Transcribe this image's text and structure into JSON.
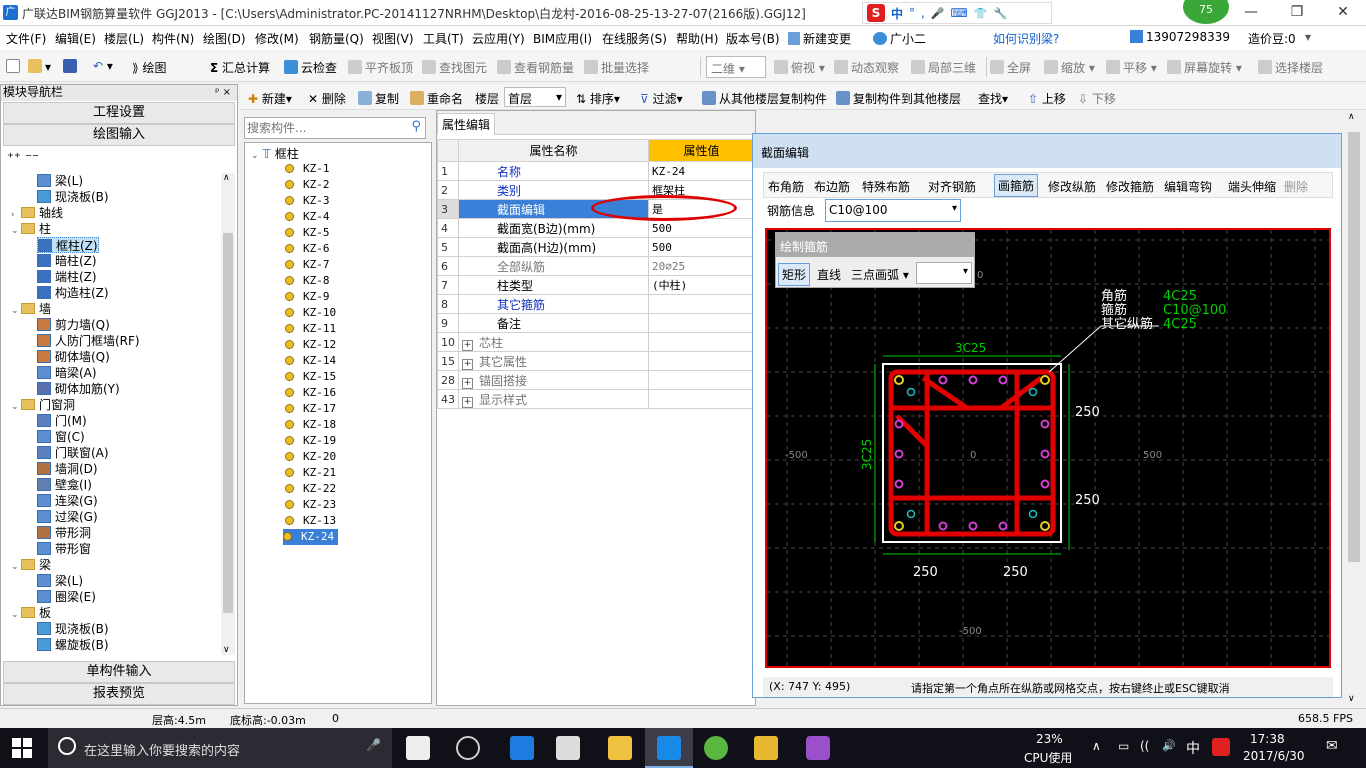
{
  "title": {
    "text": "广联达BIM钢筋算量软件 GGJ2013 - [C:\\Users\\Administrator.PC-20141127NRHM\\Desktop\\白龙村-2016-08-25-13-27-07(2166版).GGJ12]",
    "badge": "75",
    "controls": [
      "—",
      "❐",
      "✕"
    ],
    "ime": "中",
    "ime_icons": [
      "°",
      ",",
      "🎤",
      "⌨",
      "👕",
      "🔧"
    ]
  },
  "menu": [
    "文件(F)",
    "编辑(E)",
    "楼层(L)",
    "构件(N)",
    "绘图(D)",
    "修改(M)",
    "钢筋量(Q)",
    "视图(V)",
    "工具(T)",
    "云应用(Y)",
    "BIM应用(I)",
    "在线服务(S)",
    "帮助(H)",
    "版本号(B)",
    "新建变更",
    "广小二",
    "如何识别梁?",
    "13907298339",
    "造价豆:0"
  ],
  "toolbar1": {
    "draw": "绘图",
    "sum": "汇总计算",
    "cloud": "云检查",
    "flat": "平齐板顶",
    "find": "查找图元",
    "view_rebar": "查看钢筋量",
    "batch": "批量选择",
    "view2d": "二维",
    "top": "俯视",
    "dyn": "动态观察",
    "local3d": "局部三维",
    "full": "全屏",
    "zoom": "缩放",
    "pan": "平移",
    "rotate": "屏幕旋转",
    "floor": "选择楼层"
  },
  "toolbar2": {
    "new": "新建",
    "delete": "删除",
    "copy": "复制",
    "rename": "重命名",
    "floor_label": "楼层",
    "floor_value": "首层",
    "sort": "排序",
    "filter": "过滤",
    "copy_from": "从其他楼层复制构件",
    "copy_to": "复制构件到其他楼层",
    "find": "查找",
    "up": "上移",
    "down": "下移"
  },
  "left_panel": {
    "header": "模块导航栏",
    "pin": "ᵖ ×",
    "btn_project": "工程设置",
    "btn_draw": "绘图输入",
    "btn_single": "单构件输入",
    "btn_report": "报表预览",
    "tree": [
      {
        "level": 2,
        "label": "梁(L)",
        "icon": "beam-icon"
      },
      {
        "level": 2,
        "label": "现浇板(B)",
        "icon": "slab-icon"
      },
      {
        "level": 1,
        "label": "轴线",
        "icon": "folder-icon",
        "exp": "›"
      },
      {
        "level": 1,
        "label": "柱",
        "icon": "folder-icon",
        "exp": "⌄"
      },
      {
        "level": 2,
        "label": "框柱(Z)",
        "icon": "column-icon",
        "selected": true
      },
      {
        "level": 2,
        "label": "暗柱(Z)",
        "icon": "column-icon"
      },
      {
        "level": 2,
        "label": "端柱(Z)",
        "icon": "column-icon"
      },
      {
        "level": 2,
        "label": "构造柱(Z)",
        "icon": "column-icon"
      },
      {
        "level": 1,
        "label": "墙",
        "icon": "folder-icon",
        "exp": "⌄"
      },
      {
        "level": 2,
        "label": "剪力墙(Q)",
        "icon": "wall-icon"
      },
      {
        "level": 2,
        "label": "人防门框墙(RF)",
        "icon": "wall-icon"
      },
      {
        "level": 2,
        "label": "砌体墙(Q)",
        "icon": "wall-icon"
      },
      {
        "level": 2,
        "label": "暗梁(A)",
        "icon": "beam-icon"
      },
      {
        "level": 2,
        "label": "砌体加筋(Y)",
        "icon": "rebar-icon"
      },
      {
        "level": 1,
        "label": "门窗洞",
        "icon": "folder-icon",
        "exp": "⌄"
      },
      {
        "level": 2,
        "label": "门(M)",
        "icon": "door-icon"
      },
      {
        "level": 2,
        "label": "窗(C)",
        "icon": "window-icon"
      },
      {
        "level": 2,
        "label": "门联窗(A)",
        "icon": "door-icon"
      },
      {
        "level": 2,
        "label": "墙洞(D)",
        "icon": "hole-icon"
      },
      {
        "level": 2,
        "label": "壁龛(I)",
        "icon": "niche-icon"
      },
      {
        "level": 2,
        "label": "连梁(G)",
        "icon": "beam-icon"
      },
      {
        "level": 2,
        "label": "过梁(G)",
        "icon": "beam-icon"
      },
      {
        "level": 2,
        "label": "带形洞",
        "icon": "hole-icon"
      },
      {
        "level": 2,
        "label": "带形窗",
        "icon": "window-icon"
      },
      {
        "level": 1,
        "label": "梁",
        "icon": "folder-icon",
        "exp": "⌄"
      },
      {
        "level": 2,
        "label": "梁(L)",
        "icon": "beam-icon"
      },
      {
        "level": 2,
        "label": "圈梁(E)",
        "icon": "beam-icon"
      },
      {
        "level": 1,
        "label": "板",
        "icon": "folder-icon",
        "exp": "⌄"
      },
      {
        "level": 2,
        "label": "现浇板(B)",
        "icon": "slab-icon"
      },
      {
        "level": 2,
        "label": "螺旋板(B)",
        "icon": "slab-icon"
      }
    ]
  },
  "component_list": {
    "search_placeholder": "搜索构件...",
    "root": "框柱",
    "items": [
      "KZ-1",
      "KZ-2",
      "KZ-3",
      "KZ-4",
      "KZ-5",
      "KZ-6",
      "KZ-7",
      "KZ-8",
      "KZ-9",
      "KZ-10",
      "KZ-11",
      "KZ-12",
      "KZ-14",
      "KZ-15",
      "KZ-16",
      "KZ-17",
      "KZ-18",
      "KZ-19",
      "KZ-20",
      "KZ-21",
      "KZ-22",
      "KZ-23",
      "KZ-13",
      "KZ-24"
    ],
    "selected": "KZ-24"
  },
  "properties": {
    "tab": "属性编辑",
    "col_name": "属性名称",
    "col_value": "属性值",
    "rows": [
      {
        "num": "1",
        "name": "名称",
        "value": "KZ-24",
        "style": "blue"
      },
      {
        "num": "2",
        "name": "类别",
        "value": "框架柱",
        "style": "blue"
      },
      {
        "num": "3",
        "name": "截面编辑",
        "value": "是",
        "style": "selected"
      },
      {
        "num": "4",
        "name": "截面宽(B边)(mm)",
        "value": "500",
        "style": ""
      },
      {
        "num": "5",
        "name": "截面高(H边)(mm)",
        "value": "500",
        "style": ""
      },
      {
        "num": "6",
        "name": "全部纵筋",
        "value": "20⌀25",
        "style": "gr"
      },
      {
        "num": "7",
        "name": "柱类型",
        "value": "(中柱)",
        "style": ""
      },
      {
        "num": "8",
        "name": "其它箍筋",
        "value": "",
        "style": "blue"
      },
      {
        "num": "9",
        "name": "备注",
        "value": "",
        "style": ""
      },
      {
        "num": "10",
        "name": "芯柱",
        "value": "",
        "style": "gr",
        "exp": "+"
      },
      {
        "num": "15",
        "name": "其它属性",
        "value": "",
        "style": "gr",
        "exp": "+"
      },
      {
        "num": "28",
        "name": "锚固搭接",
        "value": "",
        "style": "gr",
        "exp": "+"
      },
      {
        "num": "43",
        "name": "显示样式",
        "value": "",
        "style": "gr",
        "exp": "+"
      }
    ]
  },
  "section_dialog": {
    "title": "截面编辑",
    "tools": [
      "布角筋",
      "布边筋",
      "特殊布筋",
      "对齐钢筋",
      "画箍筋",
      "修改纵筋",
      "修改箍筋",
      "编辑弯钩",
      "端头伸缩",
      "删除"
    ],
    "active_tool": "画箍筋",
    "rebar_info_label": "钢筋信息",
    "rebar_info_value": "C10@100",
    "draw_panel_title": "绘制箍筋",
    "draw_modes": [
      "矩形",
      "直线",
      "三点画弧"
    ],
    "legend": [
      {
        "label": "角筋",
        "value": "4C25"
      },
      {
        "label": "箍筋",
        "value": "C10@100"
      },
      {
        "label": "其它纵筋",
        "value": "4C25"
      }
    ],
    "dim_top": "3C25",
    "dim_left": "3C25",
    "dim_right": [
      "250",
      "250"
    ],
    "dim_bottom": [
      "250",
      "250"
    ],
    "axis_ticks": [
      "0",
      "-500",
      "500",
      "0",
      "-500"
    ],
    "status_coord": "(X: 747 Y: 495)",
    "status_msg": "请指定第一个角点所在纵筋或网格交点，按右键终止或ESC键取消"
  },
  "statusbar": {
    "floor_height": "层高:4.5m",
    "bottom_height": "底标高:-0.03m",
    "zero": "0",
    "fps": "658.5 FPS"
  },
  "taskbar": {
    "search_placeholder": "在这里输入你要搜索的内容",
    "cpu_pct": "23%",
    "cpu_label": "CPU使用",
    "ime": "中",
    "time": "17:38",
    "date": "2017/6/30",
    "tray_icons": [
      "∧",
      "▭",
      "((",
      "🔊"
    ],
    "notif": "✉"
  },
  "colors": {
    "accent": "#ffc000",
    "canvas_bg": "#000000",
    "rebar": "#e00000",
    "dim": "#00d000"
  }
}
